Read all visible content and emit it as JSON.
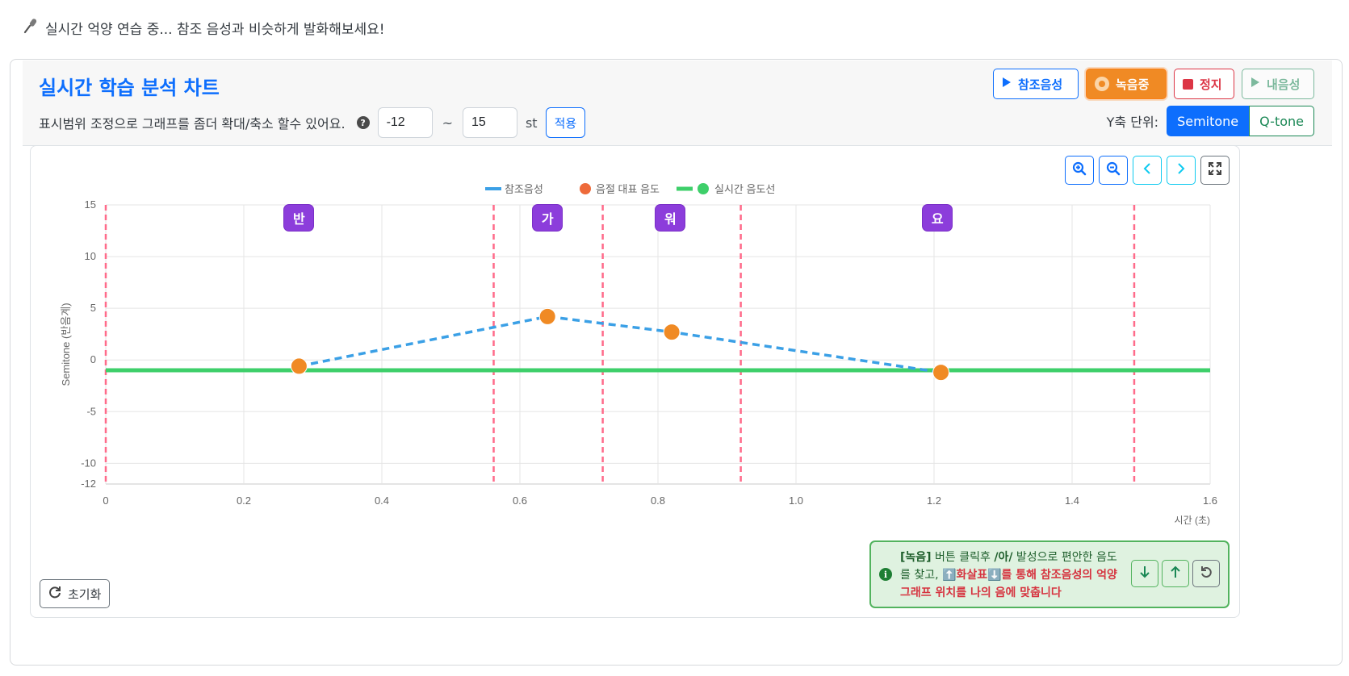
{
  "status": {
    "text": "실시간 억양 연습 중... 참조 음성과 비슷하게 발화해보세요!"
  },
  "header": {
    "title": "실시간 학습 분석 차트",
    "hint": "표시범위 조정으로 그래프를 좀더 확대/축소 할수 있어요.",
    "range_min": "-12",
    "range_sep": "~",
    "range_max": "15",
    "range_unit": "st",
    "apply_label": "적용",
    "buttons": {
      "ref": "참조음성",
      "rec": "녹음중",
      "stop": "정지",
      "mine": "내음성"
    },
    "yaxis_label": "Y축 단위:",
    "yaxis_options": [
      "Semitone",
      "Q-tone"
    ],
    "yaxis_selected": "Semitone"
  },
  "chart_data": {
    "type": "line",
    "xlabel": "시간 (초)",
    "ylabel": "Semitone (반음계)",
    "xlim": [
      0,
      1.6
    ],
    "ylim": [
      -12,
      15
    ],
    "x_ticks": [
      "0",
      "0.2",
      "0.4",
      "0.6",
      "0.8",
      "1.0",
      "1.2",
      "1.4",
      "1.6"
    ],
    "y_ticks": [
      "15",
      "10",
      "5",
      "0",
      "-5",
      "-10",
      "-12"
    ],
    "grid": true,
    "legend": {
      "placement": "top-center",
      "items": [
        "참조음성",
        "음절 대표 음도",
        "실시간 음도선"
      ]
    },
    "series": [
      {
        "name": "참조음성",
        "style": "dashed",
        "color": "#3ba0e6",
        "x": [
          0.28,
          0.64,
          0.82,
          1.21
        ],
        "y": [
          -0.6,
          4.2,
          2.7,
          -1.2
        ]
      },
      {
        "name": "음절 대표 음도",
        "style": "points",
        "color": "#f08a24",
        "x": [
          0.28,
          0.64,
          0.82,
          1.21
        ],
        "y": [
          -0.6,
          4.2,
          2.7,
          -1.2
        ]
      },
      {
        "name": "실시간 음도선",
        "style": "solid",
        "color": "#3ecf6a",
        "x": [
          0,
          1.6
        ],
        "y": [
          -1.0,
          -1.0
        ]
      }
    ],
    "boundaries": [
      0,
      0.562,
      0.72,
      0.92,
      1.49
    ],
    "boundary_color": "#ff6b8a",
    "syllables": [
      {
        "label": "반",
        "x": 0.28
      },
      {
        "label": "가",
        "x": 0.64
      },
      {
        "label": "워",
        "x": 0.818
      },
      {
        "label": "요",
        "x": 1.205
      }
    ]
  },
  "icons": {
    "zoom": [
      "zoom-in-icon",
      "zoom-out-icon",
      "chevron-left-icon",
      "chevron-right-icon",
      "expand-icon"
    ],
    "pitch": [
      "arrow-down-icon",
      "arrow-up-icon",
      "undo-icon"
    ]
  },
  "reset_label": "초기화",
  "info": {
    "part1": "[녹음]",
    "part2": " 버튼 클릭후 ",
    "part3": "/아/",
    "part4": " 발성으로 편안한 음도를 찾고, ",
    "part5": "⬆️",
    "part6": "화살표",
    "part7": "⬇️",
    "part8": "를 통해 참조음성의 억양 그래프 위치를 나의 음에 맞춥니다"
  },
  "colors": {
    "primary": "#0d6efd",
    "success": "#198754",
    "danger": "#dc3545",
    "warning": "#f08a24",
    "purple": "#8c3ddb"
  }
}
